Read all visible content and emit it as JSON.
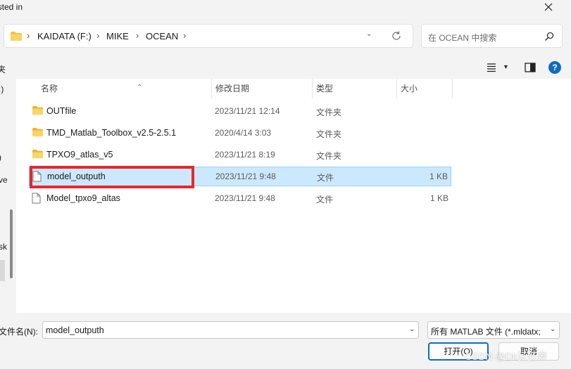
{
  "window": {
    "title_fragment": "isted in"
  },
  "address_bar": {
    "crumbs": [
      "KAIDATA (F:)",
      "MIKE",
      "OCEAN"
    ],
    "separator": "›"
  },
  "search": {
    "placeholder": "在 OCEAN 中搜索"
  },
  "toolbar": {
    "left_fragment": "夹",
    "help_label": "?"
  },
  "nav_pane": {
    "fragments": [
      ":)",
      ")",
      "ve",
      "sk"
    ]
  },
  "columns": {
    "name": "名称",
    "date": "修改日期",
    "type": "类型",
    "size": "大小"
  },
  "files": [
    {
      "name": "OUTfile",
      "date": "2023/11/21 12:14",
      "type": "文件夹",
      "size": "",
      "kind": "folder",
      "selected": false
    },
    {
      "name": "TMD_Matlab_Toolbox_v2.5-2.5.1",
      "date": "2020/4/14 3:03",
      "type": "文件夹",
      "size": "",
      "kind": "folder",
      "selected": false
    },
    {
      "name": "TPXO9_atlas_v5",
      "date": "2023/11/21 8:19",
      "type": "文件夹",
      "size": "",
      "kind": "folder",
      "selected": false
    },
    {
      "name": "model_outputh",
      "date": "2023/11/21 9:48",
      "type": "文件",
      "size": "1 KB",
      "kind": "file",
      "selected": true
    },
    {
      "name": "Model_tpxo9_altas",
      "date": "2023/11/21 9:48",
      "type": "文件",
      "size": "1 KB",
      "kind": "file",
      "selected": false
    }
  ],
  "footer": {
    "filename_label": "文件名(N):",
    "filename_value": "model_outputh",
    "filter_value": "所有 MATLAB 文件 (*.mldatx;",
    "open_label": "打开(O)",
    "cancel_label": "取消",
    "watermark": "CSDN @Dk狂狂奔"
  },
  "colors": {
    "accent": "#0f6cbd",
    "selection": "#cce8ff",
    "highlight": "#e8262d",
    "folder": "#f4c542"
  }
}
